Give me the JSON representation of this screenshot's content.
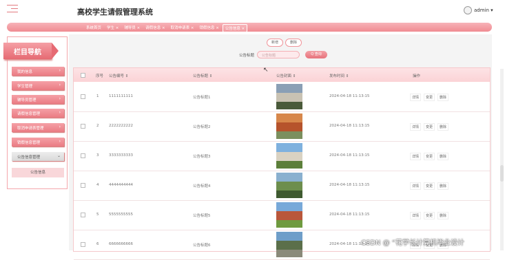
{
  "header": {
    "title": "高校学生请假管理系统",
    "user": "admin ▾"
  },
  "tabs": [
    "系统首页",
    "学生 ×",
    "辅导员 ×",
    "请假信息 ×",
    "取消申请表 ×",
    "销假信息 ×",
    "公告信息 ×"
  ],
  "sidebar": {
    "heading": "栏目导航",
    "items": [
      "我的信息",
      "学生管理",
      "辅导员管理",
      "请假信息管理",
      "取消申请表管理",
      "销假信息管理",
      "公告信息管理"
    ],
    "sub_item": "公告信息"
  },
  "toolbar": {
    "add": "新增",
    "delete": "删除"
  },
  "search": {
    "label": "公告标题",
    "placeholder": "公告标题",
    "button": "Q 查询"
  },
  "table": {
    "columns": [
      "序号",
      "公告编号 ⇕",
      "公告标题 ⇕",
      "公告封面 ⇕",
      "发布时间 ⇕",
      "操作"
    ],
    "rows": [
      {
        "index": "1",
        "code": "1111111111",
        "title": "公告标题1",
        "time": "2024-04-18 11:13:15"
      },
      {
        "index": "2",
        "code": "2222222222",
        "title": "公告标题2",
        "time": "2024-04-18 11:13:15"
      },
      {
        "index": "3",
        "code": "3333333333",
        "title": "公告标题3",
        "time": "2024-04-18 11:13:15"
      },
      {
        "index": "4",
        "code": "4444444444",
        "title": "公告标题4",
        "time": "2024-04-18 11:13:15"
      },
      {
        "index": "5",
        "code": "5555555555",
        "title": "公告标题5",
        "time": "2024-04-18 11:13:15"
      },
      {
        "index": "6",
        "code": "6666666666",
        "title": "公告标题6",
        "time": "2024-04-18 11:13:15"
      }
    ],
    "actions": [
      "详情",
      "变更",
      "删除"
    ]
  },
  "watermark": "CSDN @ “花学长计算机毕业设计",
  "colors": {
    "accent": "#f08b92",
    "accent_dark": "#e66a73",
    "pale": "#fde3e5"
  }
}
